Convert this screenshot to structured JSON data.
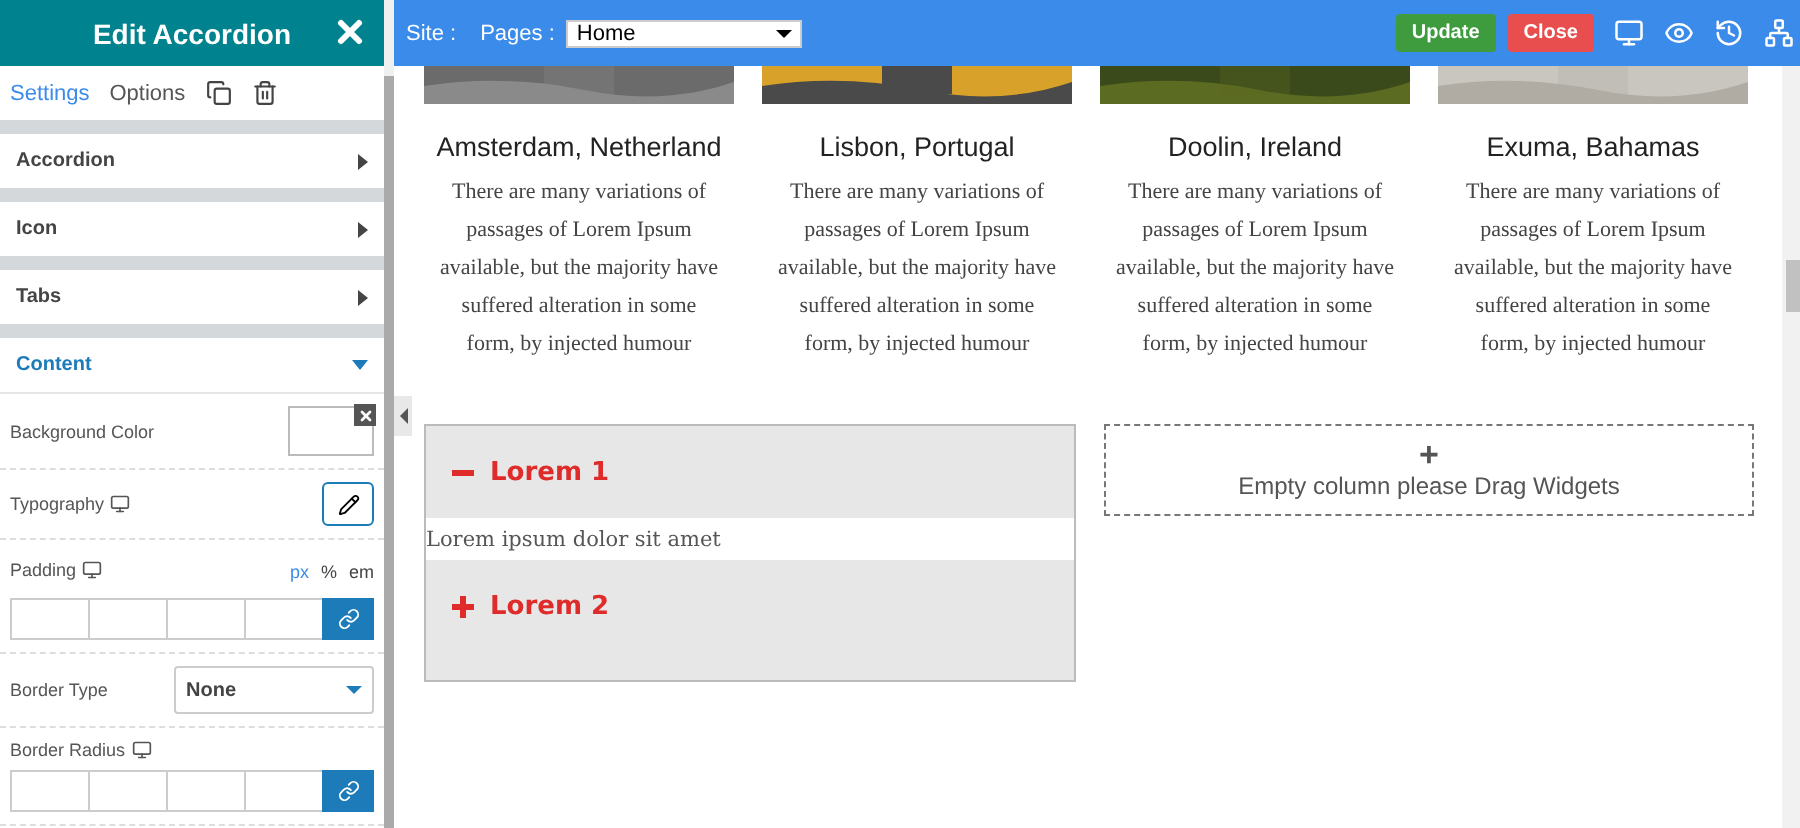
{
  "panel": {
    "title": "Edit Accordion",
    "tabs": [
      {
        "label": "Settings",
        "selected": true
      },
      {
        "label": "Options",
        "selected": false
      }
    ],
    "sections": [
      {
        "label": "Accordion",
        "expanded": false
      },
      {
        "label": "Icon",
        "expanded": false
      },
      {
        "label": "Tabs",
        "expanded": false
      },
      {
        "label": "Content",
        "expanded": true
      }
    ],
    "fields": [
      {
        "kind": "color",
        "label": "Background Color"
      },
      {
        "kind": "typography",
        "label": "Typography",
        "responsive": true
      },
      {
        "kind": "dimensions",
        "label": "Padding",
        "responsive": true,
        "units": [
          {
            "label": "px",
            "selected": true
          },
          {
            "label": "%",
            "selected": false
          },
          {
            "label": "em",
            "selected": false
          }
        ]
      },
      {
        "kind": "select",
        "label": "Border Type",
        "value": "None"
      },
      {
        "kind": "dimensions",
        "label": "Border Radius",
        "responsive": true
      }
    ]
  },
  "toolbar": {
    "site_label": "Site :",
    "pages_label": "Pages :",
    "page": "Home",
    "buttons": [
      {
        "label": "Update",
        "kind": "update"
      },
      {
        "label": "Close",
        "kind": "close"
      }
    ]
  },
  "cards": [
    {
      "title": "Amsterdam, Netherland",
      "text": "There are many variations of passages of Lorem Ipsum available, but the majority have suffered alteration in some form, by injected humour",
      "kind": "picture"
    },
    {
      "title": "Lisbon, Portugal",
      "text": "There are many variations of passages of Lorem Ipsum available, but the majority have suffered alteration in some form, by injected humour",
      "kind": "picture"
    },
    {
      "title": "Doolin, Ireland",
      "text": "There are many variations of passages of Lorem Ipsum available, but the majority have suffered alteration in some form, by injected humour",
      "kind": "picture"
    },
    {
      "title": "Exuma, Bahamas",
      "text": "There are many variations of passages of Lorem Ipsum available, but the majority have suffered alteration in some form, by injected humour",
      "kind": "picture"
    }
  ],
  "accordion": [
    {
      "title": "Lorem 1",
      "expanded": true,
      "body": "Lorem ipsum dolor sit amet"
    },
    {
      "title": "Lorem 2",
      "expanded": false
    }
  ],
  "empty_column": {
    "icon": "+",
    "text": "Empty column please Drag Widgets"
  }
}
